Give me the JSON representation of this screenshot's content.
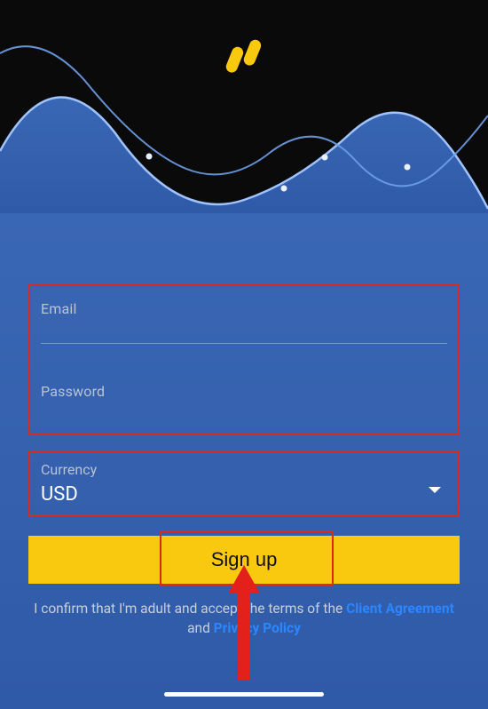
{
  "logo": {
    "name": "brand-logo"
  },
  "form": {
    "email": {
      "label": "Email",
      "value": ""
    },
    "password": {
      "label": "Password",
      "value": ""
    },
    "currency": {
      "label": "Currency",
      "value": "USD"
    }
  },
  "actions": {
    "signup_label": "Sign up"
  },
  "disclaimer": {
    "prefix": "I confirm that I'm adult and accept the terms of the ",
    "link1": "Client Agreement",
    "mid": " and ",
    "link2": "Privacy Policy"
  },
  "colors": {
    "accent": "#f8c90f",
    "highlight_box": "#d62b1f",
    "link": "#2b86ff"
  }
}
